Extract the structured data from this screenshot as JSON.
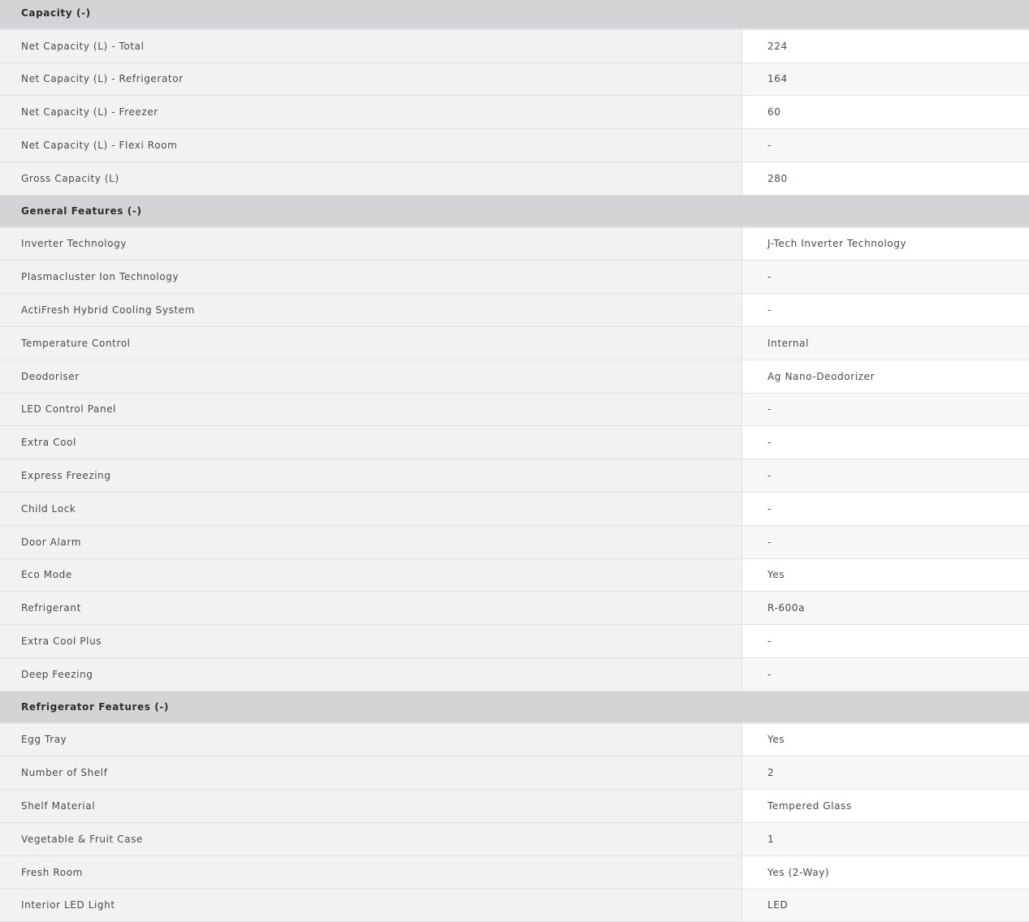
{
  "sections": [
    {
      "title": "Capacity (-)",
      "rows": [
        {
          "label": "Net Capacity (L) - Total",
          "value": "224"
        },
        {
          "label": "Net Capacity (L) - Refrigerator",
          "value": "164"
        },
        {
          "label": "Net Capacity (L) - Freezer",
          "value": "60"
        },
        {
          "label": "Net Capacity (L) - Flexi Room",
          "value": "-"
        },
        {
          "label": "Gross Capacity (L)",
          "value": "280"
        }
      ]
    },
    {
      "title": "General Features (-)",
      "rows": [
        {
          "label": "Inverter Technology",
          "value": "J-Tech Inverter Technology"
        },
        {
          "label": "Plasmacluster Ion Technology",
          "value": "-"
        },
        {
          "label": "ActiFresh Hybrid Cooling System",
          "value": "-"
        },
        {
          "label": "Temperature Control",
          "value": "Internal"
        },
        {
          "label": "Deodoriser",
          "value": "Ag Nano-Deodorizer"
        },
        {
          "label": "LED Control Panel",
          "value": "-"
        },
        {
          "label": "Extra Cool",
          "value": "-"
        },
        {
          "label": "Express Freezing",
          "value": "-"
        },
        {
          "label": "Child Lock",
          "value": "-"
        },
        {
          "label": "Door Alarm",
          "value": "-"
        },
        {
          "label": "Eco Mode",
          "value": "Yes"
        },
        {
          "label": "Refrigerant",
          "value": "R-600a"
        },
        {
          "label": "Extra Cool Plus",
          "value": "-"
        },
        {
          "label": "Deep Feezing",
          "value": "-"
        }
      ]
    },
    {
      "title": "Refrigerator Features (-)",
      "rows": [
        {
          "label": "Egg Tray",
          "value": "Yes"
        },
        {
          "label": "Number of Shelf",
          "value": "2"
        },
        {
          "label": "Shelf Material",
          "value": "Tempered Glass"
        },
        {
          "label": "Vegetable & Fruit Case",
          "value": "1"
        },
        {
          "label": "Fresh Room",
          "value": "Yes (2-Way)"
        },
        {
          "label": "Interior LED Light",
          "value": "LED"
        }
      ]
    }
  ]
}
